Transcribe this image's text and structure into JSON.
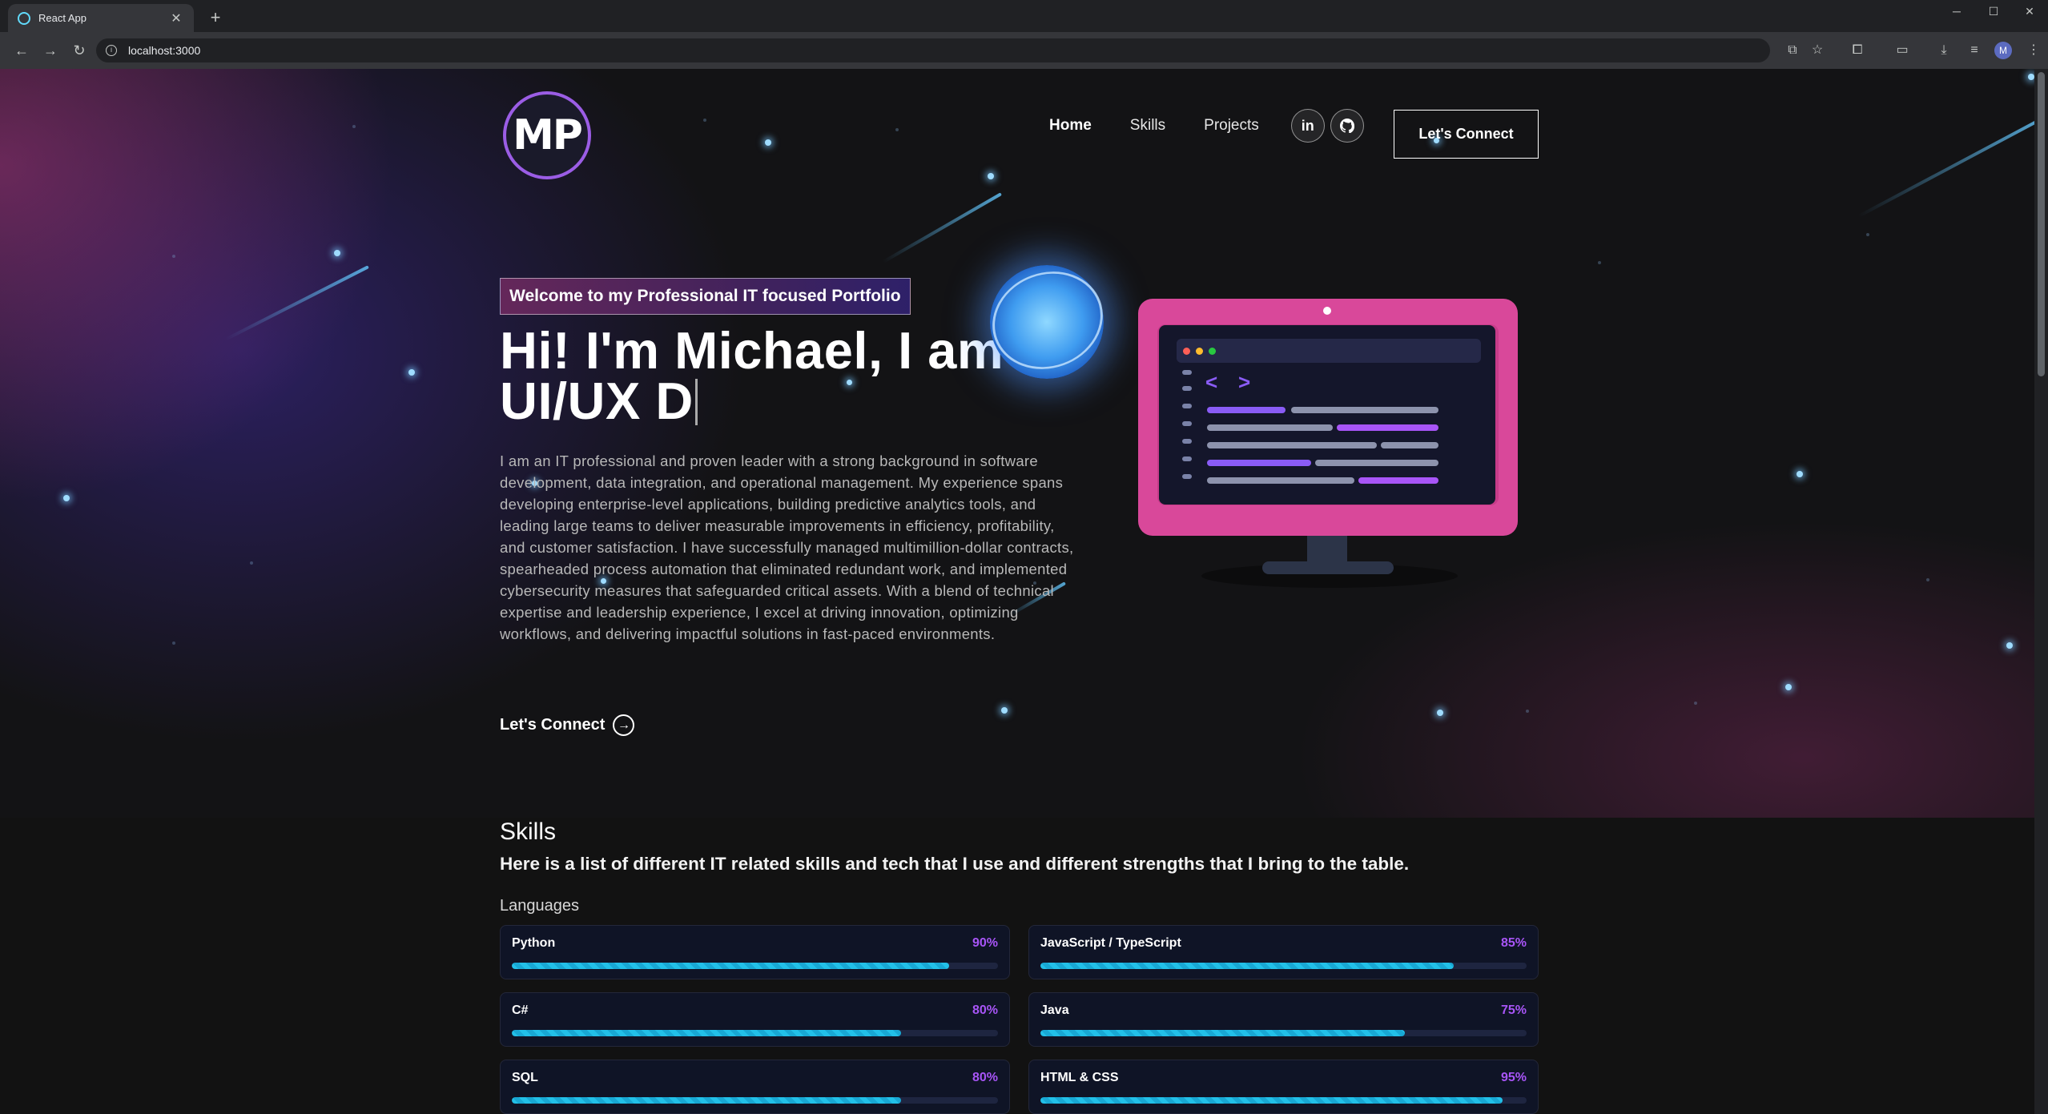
{
  "browser": {
    "tab_title": "React App",
    "url": "localhost:3000",
    "profile_initial": "M"
  },
  "nav": {
    "logo_text": "MP",
    "links": [
      "Home",
      "Skills",
      "Projects"
    ],
    "social": [
      "in",
      "github-icon"
    ],
    "connect_label": "Let's Connect"
  },
  "hero": {
    "tagline": "Welcome to my Professional IT focused Portfolio",
    "title_line1": "Hi! I'm Michael, I am a",
    "title_line2": "UI/UX D",
    "description": "I am an IT professional and proven leader with a strong background in software development, data integration, and operational management. My experience spans developing enterprise-level applications, building predictive analytics tools, and leading large teams to deliver measurable improvements in efficiency, profitability, and customer satisfaction. I have successfully managed multimillion-dollar contracts, spearheaded process automation that eliminated redundant work, and implemented cybersecurity measures that safeguarded critical assets. With a blend of technical expertise and leadership experience, I excel at driving innovation, optimizing workflows, and delivering impactful solutions in fast-paced environments.",
    "connect_label": "Let's Connect"
  },
  "skills": {
    "title": "Skills",
    "subtitle": "Here is a list of different IT related skills and tech that I use and different strengths that I bring to the table.",
    "category": "Languages",
    "items": [
      {
        "name": "Python",
        "pct": "90%",
        "value": 0.9
      },
      {
        "name": "JavaScript / TypeScript",
        "pct": "85%",
        "value": 0.85
      },
      {
        "name": "C#",
        "pct": "80%",
        "value": 0.8
      },
      {
        "name": "Java",
        "pct": "75%",
        "value": 0.75
      },
      {
        "name": "SQL",
        "pct": "80%",
        "value": 0.8
      },
      {
        "name": "HTML & CSS",
        "pct": "95%",
        "value": 0.95
      }
    ]
  },
  "colors": {
    "accent_purple": "#a855f7",
    "bar_cyan": "#22c0e8",
    "monitor_pink": "#d9489a"
  }
}
